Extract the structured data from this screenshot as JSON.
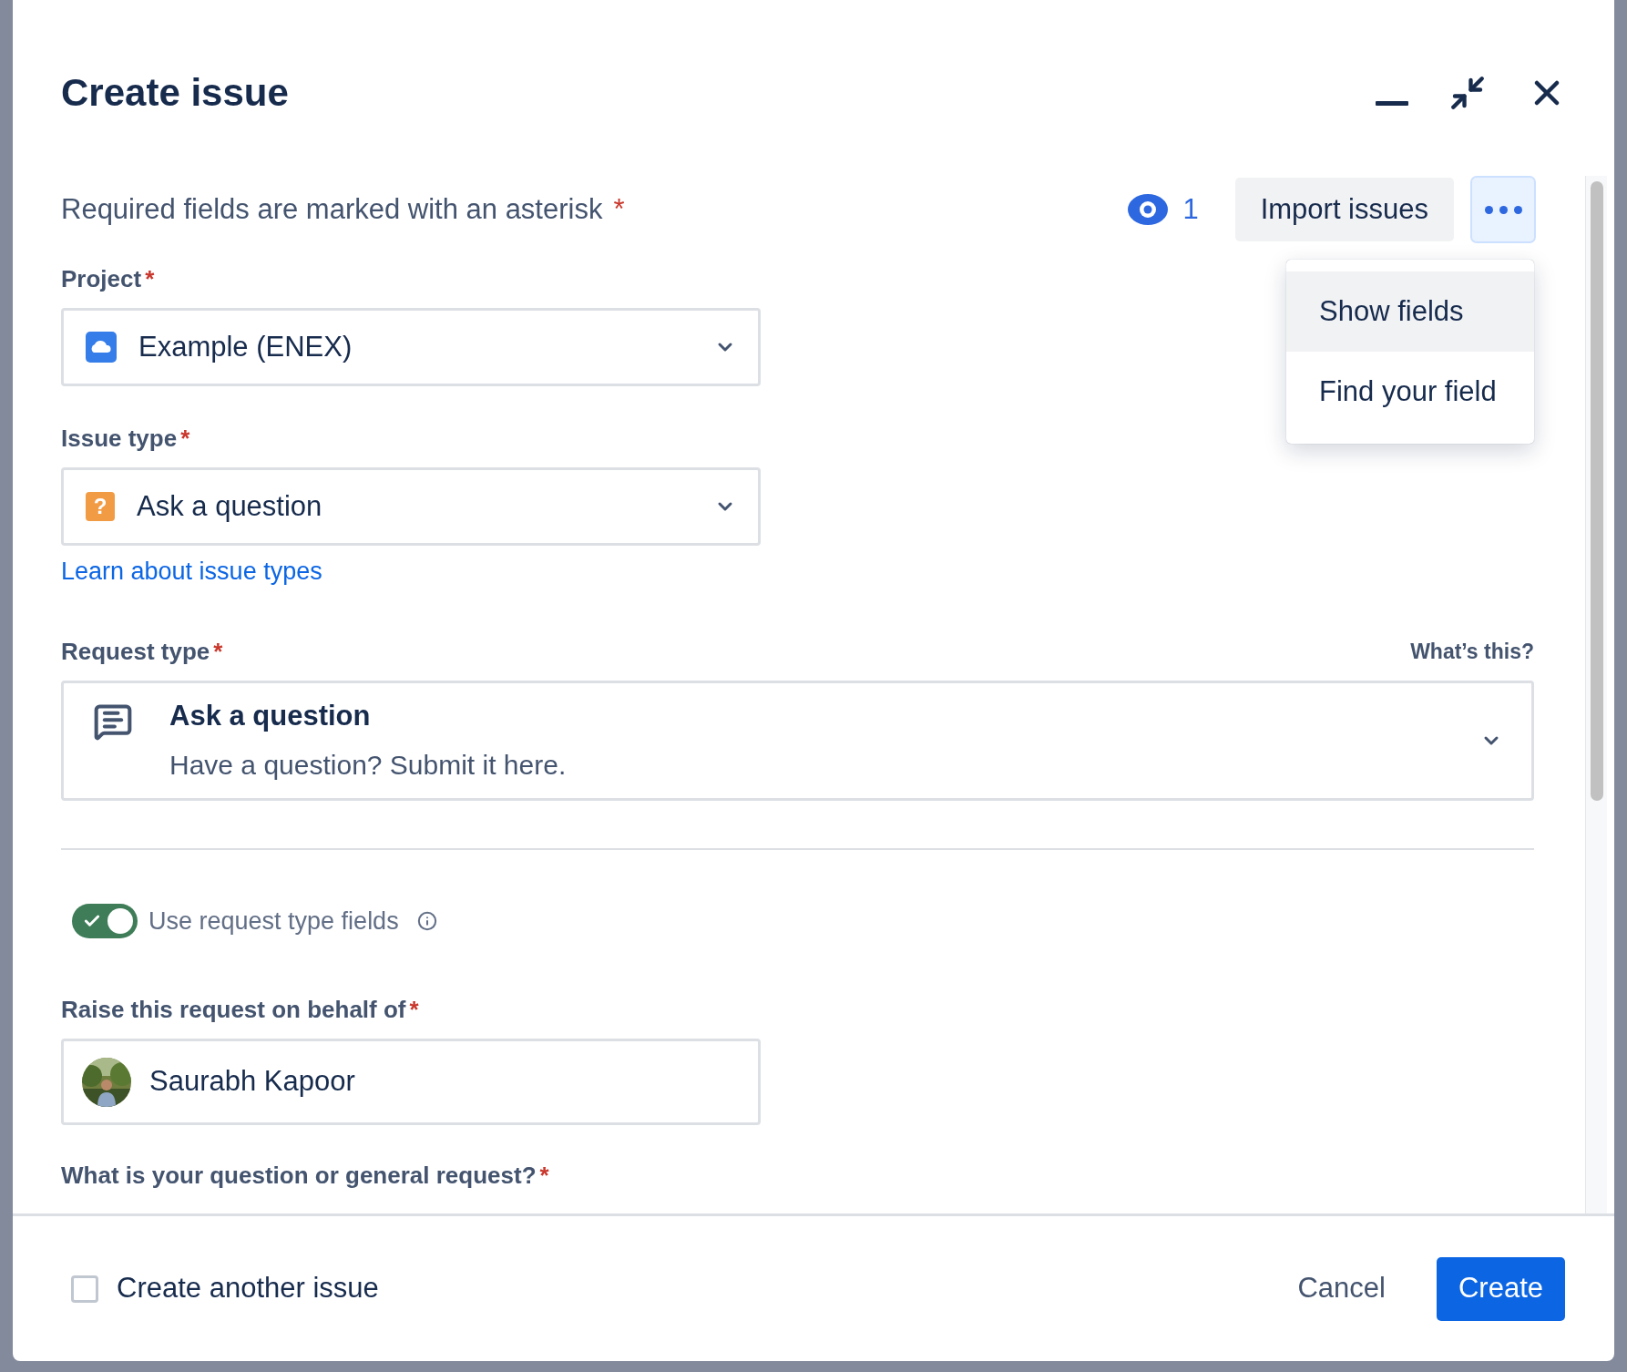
{
  "window": {
    "title": "Create issue"
  },
  "required_note": {
    "text": "Required fields are marked with an asterisk",
    "marker": "*"
  },
  "watchers": {
    "count": "1"
  },
  "import_button": {
    "label": "Import issues"
  },
  "more_button": {
    "expanded": true
  },
  "menu": [
    {
      "label": "Show fields",
      "selected": true
    },
    {
      "label": "Find your field",
      "selected": false
    }
  ],
  "fields": [
    {
      "kind": "project",
      "label": "Project",
      "required": true,
      "value": "Example (ENEX)"
    },
    {
      "kind": "issue_type",
      "label": "Issue type",
      "required": true,
      "icon_glyph": "?",
      "value": "Ask a question",
      "link": "Learn about issue types"
    },
    {
      "kind": "request",
      "label": "Request type",
      "required": true,
      "hint": "What’s this?",
      "title": "Ask a question",
      "description": "Have a question? Submit it here."
    },
    {
      "kind": "toggle",
      "label": "Use request type fields",
      "on": true
    },
    {
      "kind": "user",
      "label": "Raise this request on behalf of",
      "required": true,
      "value": "Saurabh Kapoor"
    },
    {
      "kind": "heading",
      "label": "What is your question or general request?",
      "required": true
    }
  ],
  "footer": {
    "create_another": {
      "label": "Create another issue",
      "checked": false
    },
    "cancel": "Cancel",
    "create": "Create"
  }
}
